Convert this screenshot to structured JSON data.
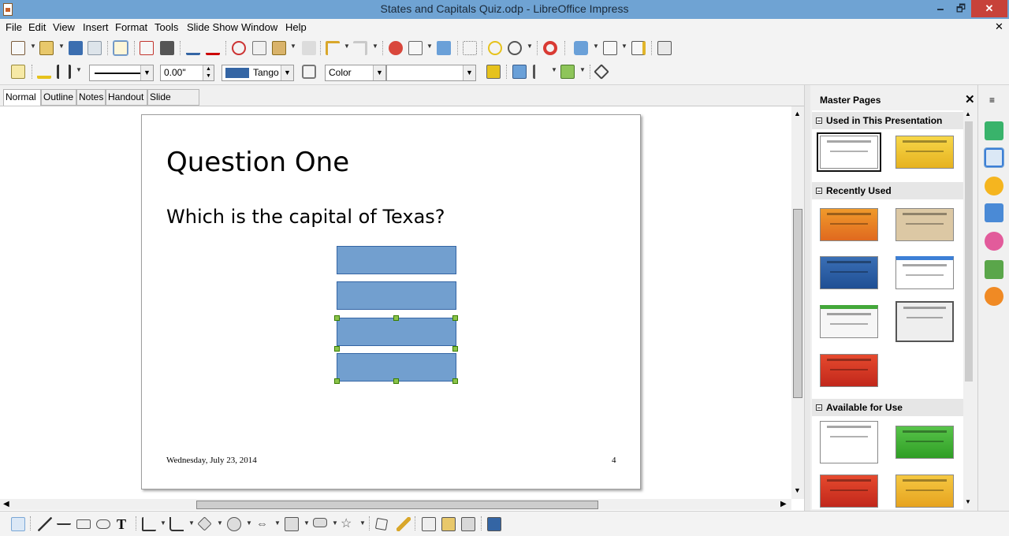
{
  "window": {
    "title": "States and Capitals Quiz.odp - LibreOffice Impress",
    "minimize": "🗕",
    "restore": "🗗",
    "close": "✕"
  },
  "menu": {
    "items": [
      "File",
      "Edit",
      "View",
      "Insert",
      "Format",
      "Tools",
      "Slide Show",
      "Window",
      "Help"
    ],
    "close_doc": "✕"
  },
  "line_format": {
    "line_width": "0.00\"",
    "line_color_name": "Tango",
    "area_style": "Color",
    "area_fill": ""
  },
  "view_tabs": [
    "Normal",
    "Outline",
    "Notes",
    "Handout",
    "Slide Sorter"
  ],
  "slide": {
    "title": "Question One",
    "question": "Which is the capital of Texas?",
    "footer_date": "Wednesday, July 23, 2014",
    "slide_number": "4",
    "answer_box_count": 4,
    "selected_boxes": [
      3,
      4
    ]
  },
  "master_pages": {
    "title": "Master Pages",
    "close": "✕",
    "sections": [
      {
        "label": "Used in This Presentation"
      },
      {
        "label": "Recently Used"
      },
      {
        "label": "Available for Use"
      }
    ]
  },
  "colors": {
    "titlebar": "#6fa3d3",
    "answer_fill": "#729fcf",
    "answer_border": "#3465a4",
    "selection_handle": "#8bc34a"
  }
}
